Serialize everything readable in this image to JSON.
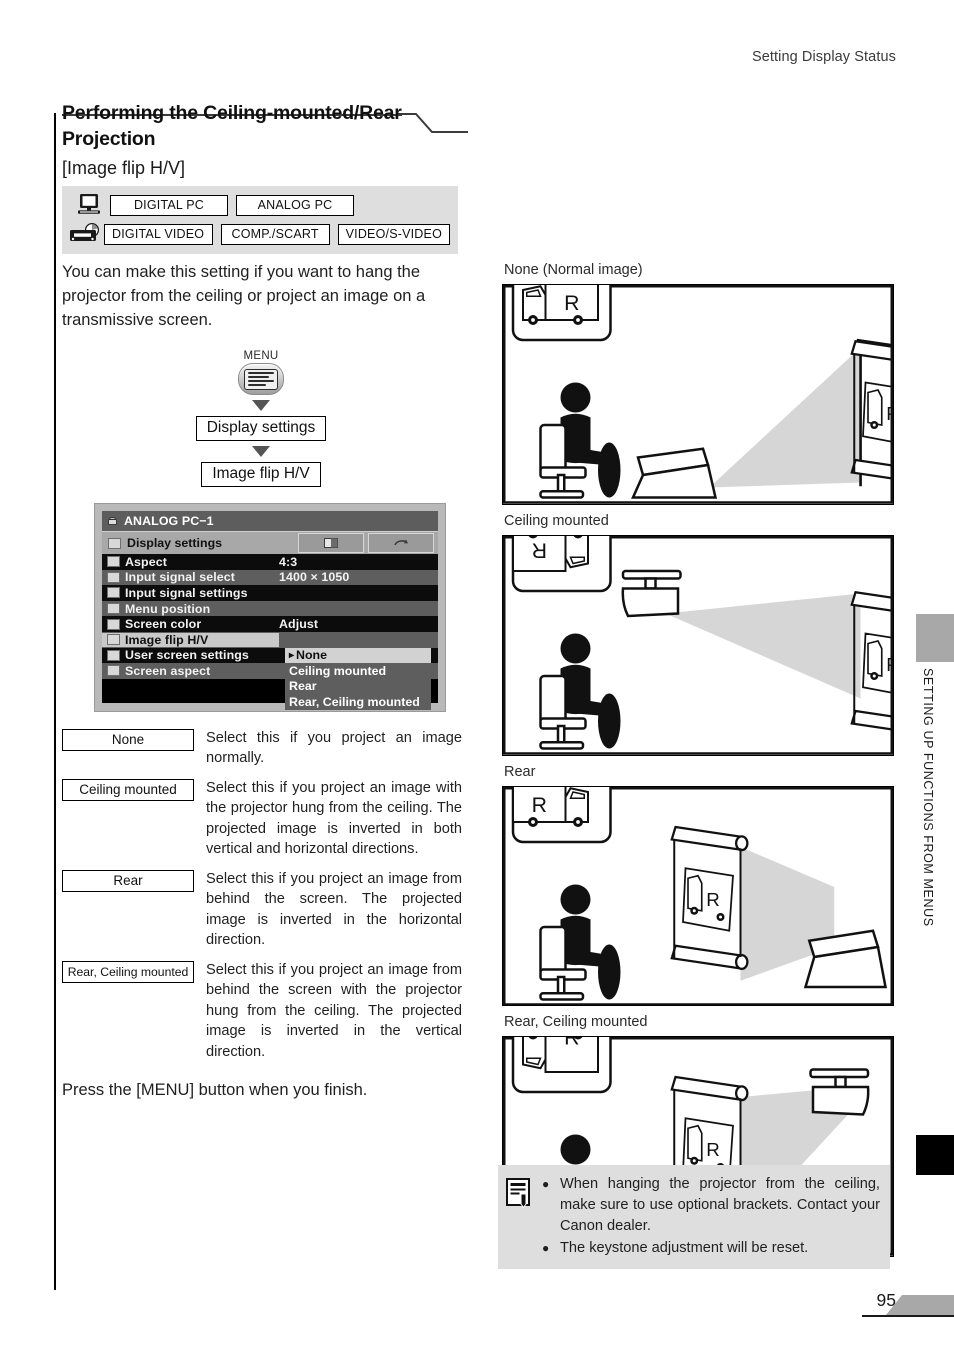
{
  "header": {
    "running_head": "Setting Display Status"
  },
  "heading": {
    "title": "Performing the Ceiling-mounted/Rear Projection",
    "subtitle": "[Image flip H/V]"
  },
  "input_badges": {
    "row1_icon": "desktop-computer-icon",
    "row2_icon": "video-deck-icon",
    "row1": [
      "DIGITAL PC",
      "ANALOG PC"
    ],
    "row2": [
      "DIGITAL VIDEO",
      "COMP./SCART",
      "VIDEO/S-VIDEO"
    ]
  },
  "intro": "You can make this setting if you want to hang the projector from the ceiling or project an image on a transmissive screen.",
  "flow": {
    "menu_label": "MENU",
    "menu_icon": "menu-button-icon",
    "step1": "Display settings",
    "step2": "Image flip H/V"
  },
  "osd": {
    "title": "ANALOG PC−1",
    "title_icon": "projector-icon",
    "section": "Display settings",
    "tab1_icon": "image-adjust-icon",
    "tab2_icon": "reset-icon",
    "rows": [
      {
        "icon": "aspect-icon",
        "label": "Aspect",
        "value": "4:3"
      },
      {
        "icon": "signal-select-icon",
        "label": "Input signal select",
        "value": "1400 × 1050"
      },
      {
        "icon": "signal-settings-icon",
        "label": "Input signal settings",
        "value": ""
      },
      {
        "icon": "menu-position-icon",
        "label": "Menu position",
        "value": ""
      },
      {
        "icon": "screen-color-icon",
        "label": "Screen color",
        "value": "Adjust"
      },
      {
        "icon": "image-flip-icon",
        "label": "Image flip H/V",
        "value": ""
      },
      {
        "icon": "user-screen-icon",
        "label": "User screen settings",
        "value": ""
      },
      {
        "icon": "screen-aspect-icon",
        "label": "Screen aspect",
        "value": ""
      }
    ],
    "popup": {
      "caret": "▸",
      "items": [
        "None",
        "Ceiling mounted",
        "Rear",
        "Rear, Ceiling mounted"
      ],
      "selected": "None"
    }
  },
  "options": [
    {
      "key": "None",
      "text": "Select this if you project an image normally."
    },
    {
      "key": "Ceiling mounted",
      "text": "Select this if you project an image with the projector hung from the ceiling. The projected image is inverted in both vertical and horizontal directions."
    },
    {
      "key": "Rear",
      "text": "Select this if you project an image from behind the screen. The projected image is inverted in the horizontal direction."
    },
    {
      "key": "Rear, Ceiling mounted",
      "text": "Select this if you project an image from behind the screen with the projector hung from the ceiling. The projected image is inverted in the vertical direction."
    }
  ],
  "closing": "Press the [MENU] button when you finish.",
  "figures": [
    {
      "caption": "None (Normal image)",
      "thumb_letter": "R",
      "screen_letter": "R"
    },
    {
      "caption": "Ceiling mounted",
      "thumb_letter": "R",
      "screen_letter": "R"
    },
    {
      "caption": "Rear",
      "thumb_letter": "R",
      "screen_letter": "R"
    },
    {
      "caption": "Rear, Ceiling mounted",
      "thumb_letter": "R",
      "screen_letter": "R"
    }
  ],
  "note": {
    "icon": "note-memo-icon",
    "bullet": "●",
    "items": [
      "When hanging the projector from the ceiling, make sure to use optional brackets. Contact your Canon dealer.",
      "The keystone adjustment will be reset."
    ]
  },
  "sidebar": {
    "chapter_label": "SETTING UP FUNCTIONS FROM MENUS"
  },
  "footer": {
    "page_number": "95"
  },
  "colors": {
    "badge_strip": "#dedede",
    "note_bg": "#dedede",
    "tab_gray": "#a8a8a8",
    "tab_black": "#000000",
    "osd_dark": "#000000",
    "osd_mid": "#5e5e5e",
    "osd_light": "#a8a8a8",
    "beam": "#d4d4d4"
  }
}
